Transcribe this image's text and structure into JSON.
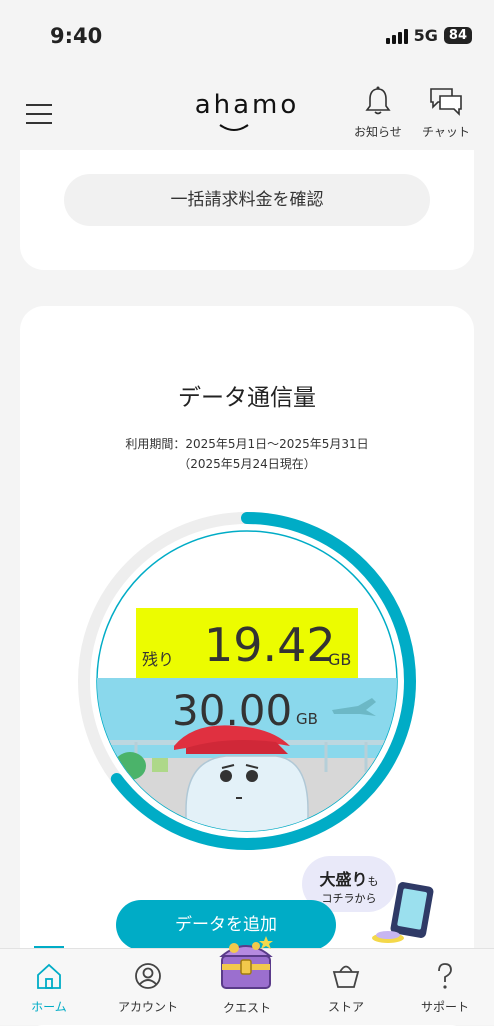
{
  "status": {
    "time": "9:40",
    "network": "5G",
    "battery": "84"
  },
  "header": {
    "logo": "ahamo",
    "notifications_label": "お知らせ",
    "chat_label": "チャット"
  },
  "billing": {
    "confirm_button": "一括請求料金を確認"
  },
  "data_usage": {
    "title": "データ通信量",
    "period": "利用期間：2025年5月1日〜2025年5月31日",
    "as_of": "（2025年5月24日現在）",
    "remaining_label": "残り",
    "remaining_value": "19.42",
    "remaining_unit": "GB",
    "total_value": "30.00",
    "total_unit": "GB",
    "remaining_fraction": 0.647
  },
  "promo": {
    "main": "大盛り",
    "suffix": "も",
    "sub": "コチラから"
  },
  "add_data_button": "データを追加",
  "tabs": [
    {
      "label": "ホーム",
      "icon": "home-icon",
      "active": true
    },
    {
      "label": "アカウント",
      "icon": "account-icon",
      "active": false
    },
    {
      "label": "クエスト",
      "icon": "quest-chest-icon",
      "active": false
    },
    {
      "label": "ストア",
      "icon": "store-icon",
      "active": false
    },
    {
      "label": "サポート",
      "icon": "support-icon",
      "active": false
    }
  ],
  "colors": {
    "accent": "#00acc6",
    "highlight": "#ecfc00",
    "background": "#f4f4f4"
  }
}
